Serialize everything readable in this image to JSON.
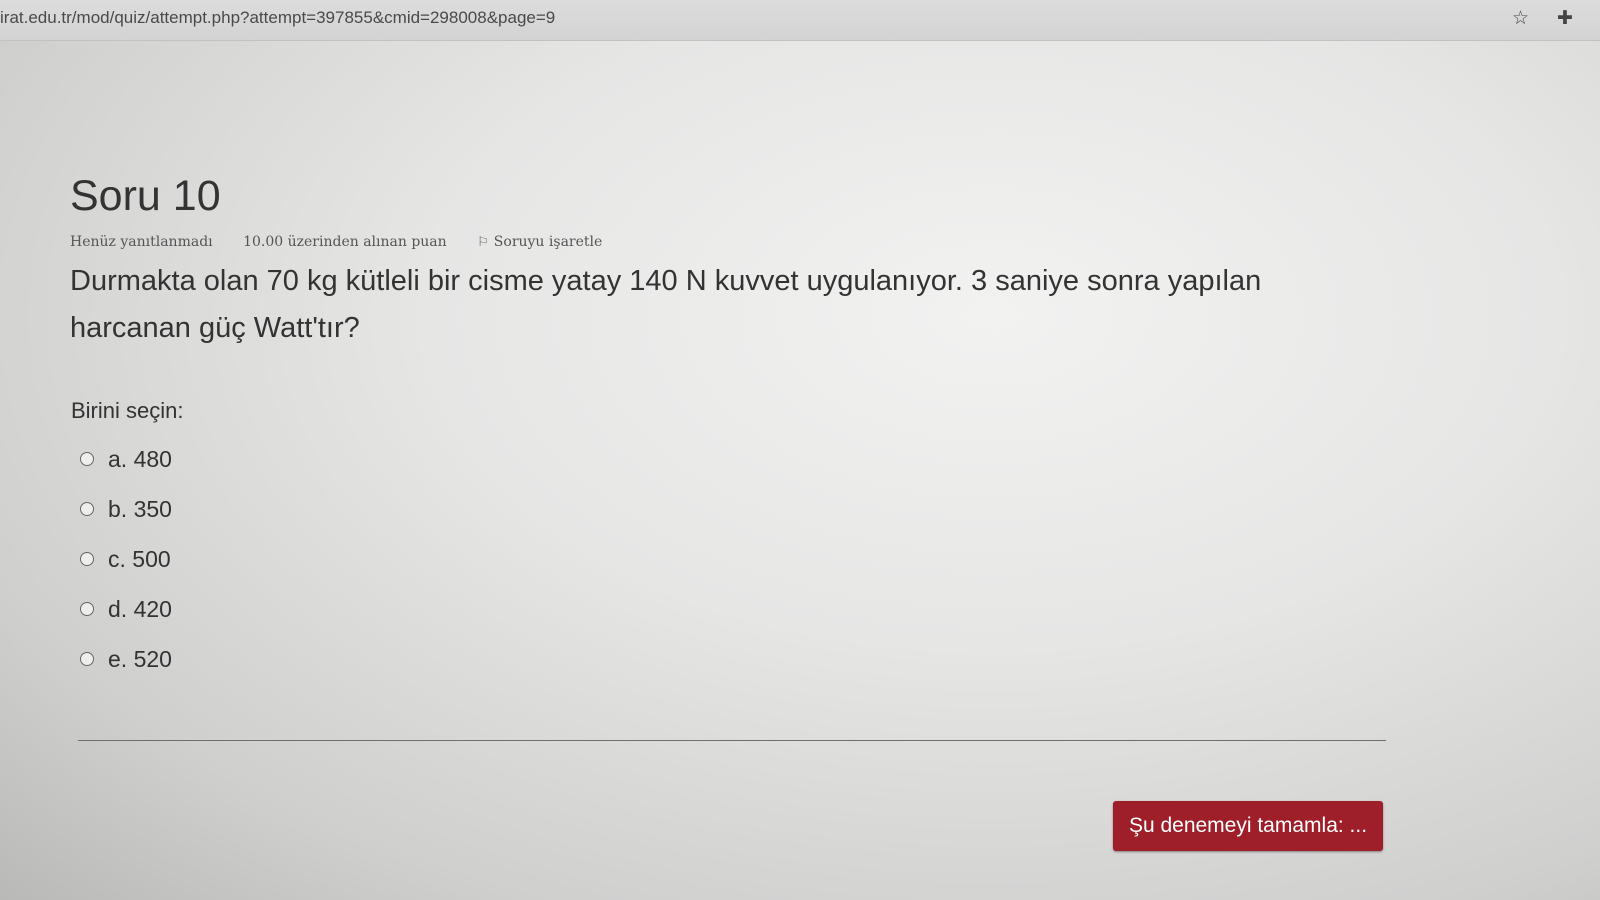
{
  "browser": {
    "url": "irat.edu.tr/mod/quiz/attempt.php?attempt=397855&cmid=298008&page=9",
    "icons": [
      "star-icon",
      "extension-puzzle-icon"
    ]
  },
  "question": {
    "title": "Soru 10",
    "state": "Henüz yanıtlanmadı",
    "grade": "10.00 üzerinden alınan puan",
    "flag_label": "Soruyu işaretle",
    "text": "Durmakta olan 70 kg kütleli bir cisme yatay 140 N kuvvet uygulanıyor. 3 saniye sonra yapılan harcanan güç Watt'tır?",
    "prompt": "Birini seçin:",
    "answers": [
      {
        "label": "a. 480"
      },
      {
        "label": "b. 350"
      },
      {
        "label": "c. 500"
      },
      {
        "label": "d. 420"
      },
      {
        "label": "e. 520"
      }
    ]
  },
  "footer": {
    "finish_button": "Şu denemeyi tamamla: ..."
  },
  "colors": {
    "finish_button_bg": "#9e1f2a",
    "text": "#333333"
  }
}
